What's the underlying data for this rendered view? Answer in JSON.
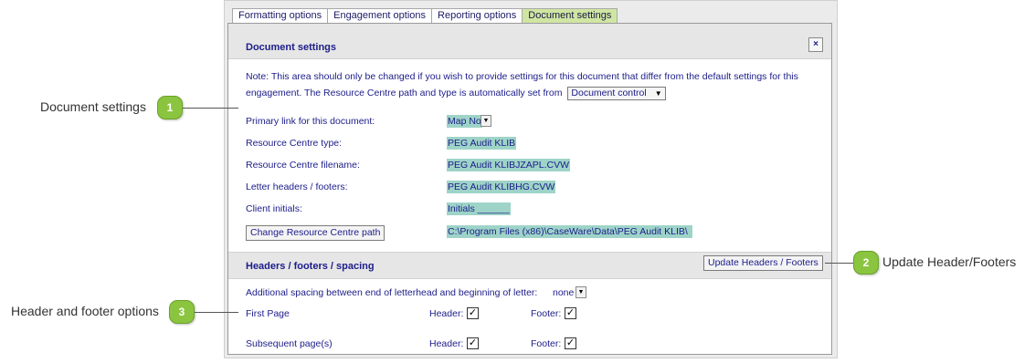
{
  "tabs": [
    {
      "label": "Formatting options",
      "active": false
    },
    {
      "label": "Engagement options",
      "active": false
    },
    {
      "label": "Reporting options",
      "active": false
    },
    {
      "label": "Document settings",
      "active": true
    }
  ],
  "document_settings": {
    "title": "Document settings",
    "close_label": "×",
    "note_line1": "Note: This area should only be changed if you wish to provide settings for this document that differ from the default settings for this",
    "note_line2": "engagement. The Resource Centre path and type is automatically set from",
    "source_select": "Document control",
    "fields": [
      {
        "label": "Primary link for this document:",
        "value": "Map No"
      },
      {
        "label": "Resource Centre type:",
        "value": "PEG Audit KLIB"
      },
      {
        "label": "Resource Centre filename:",
        "value": "PEG Audit KLIBJZAPL.CVW"
      },
      {
        "label": "Letter headers / footers:",
        "value": "PEG Audit KLIBHG.CVW"
      },
      {
        "label": "Client initials:",
        "value": "Initials ______"
      }
    ],
    "change_path_button": "Change Resource Centre path",
    "path_value": "C:\\Program Files (x86)\\CaseWare\\Data\\PEG Audit KLIB\\"
  },
  "headers_footers": {
    "title": "Headers / footers / spacing",
    "update_button": "Update Headers / Footers",
    "spacing_label": "Additional spacing between end of letterhead and beginning of letter:",
    "spacing_value": "none",
    "rows": [
      {
        "label": "First Page",
        "header_label": "Header:",
        "header_checked": true,
        "footer_label": "Footer:",
        "footer_checked": true
      },
      {
        "label": "Subsequent page(s)",
        "header_label": "Header:",
        "header_checked": true,
        "footer_label": "Footer:",
        "footer_checked": true
      }
    ]
  },
  "callouts": [
    {
      "number": "1",
      "label": "Document settings"
    },
    {
      "number": "2",
      "label": "Update Header/Footers"
    },
    {
      "number": "3",
      "label": "Header and footer options"
    }
  ],
  "colors": {
    "accent_green": "#8bc53f",
    "active_tab": "#cfe6a2",
    "text_blue": "#1c1c8a",
    "value_highlight": "#9ed4c8"
  }
}
